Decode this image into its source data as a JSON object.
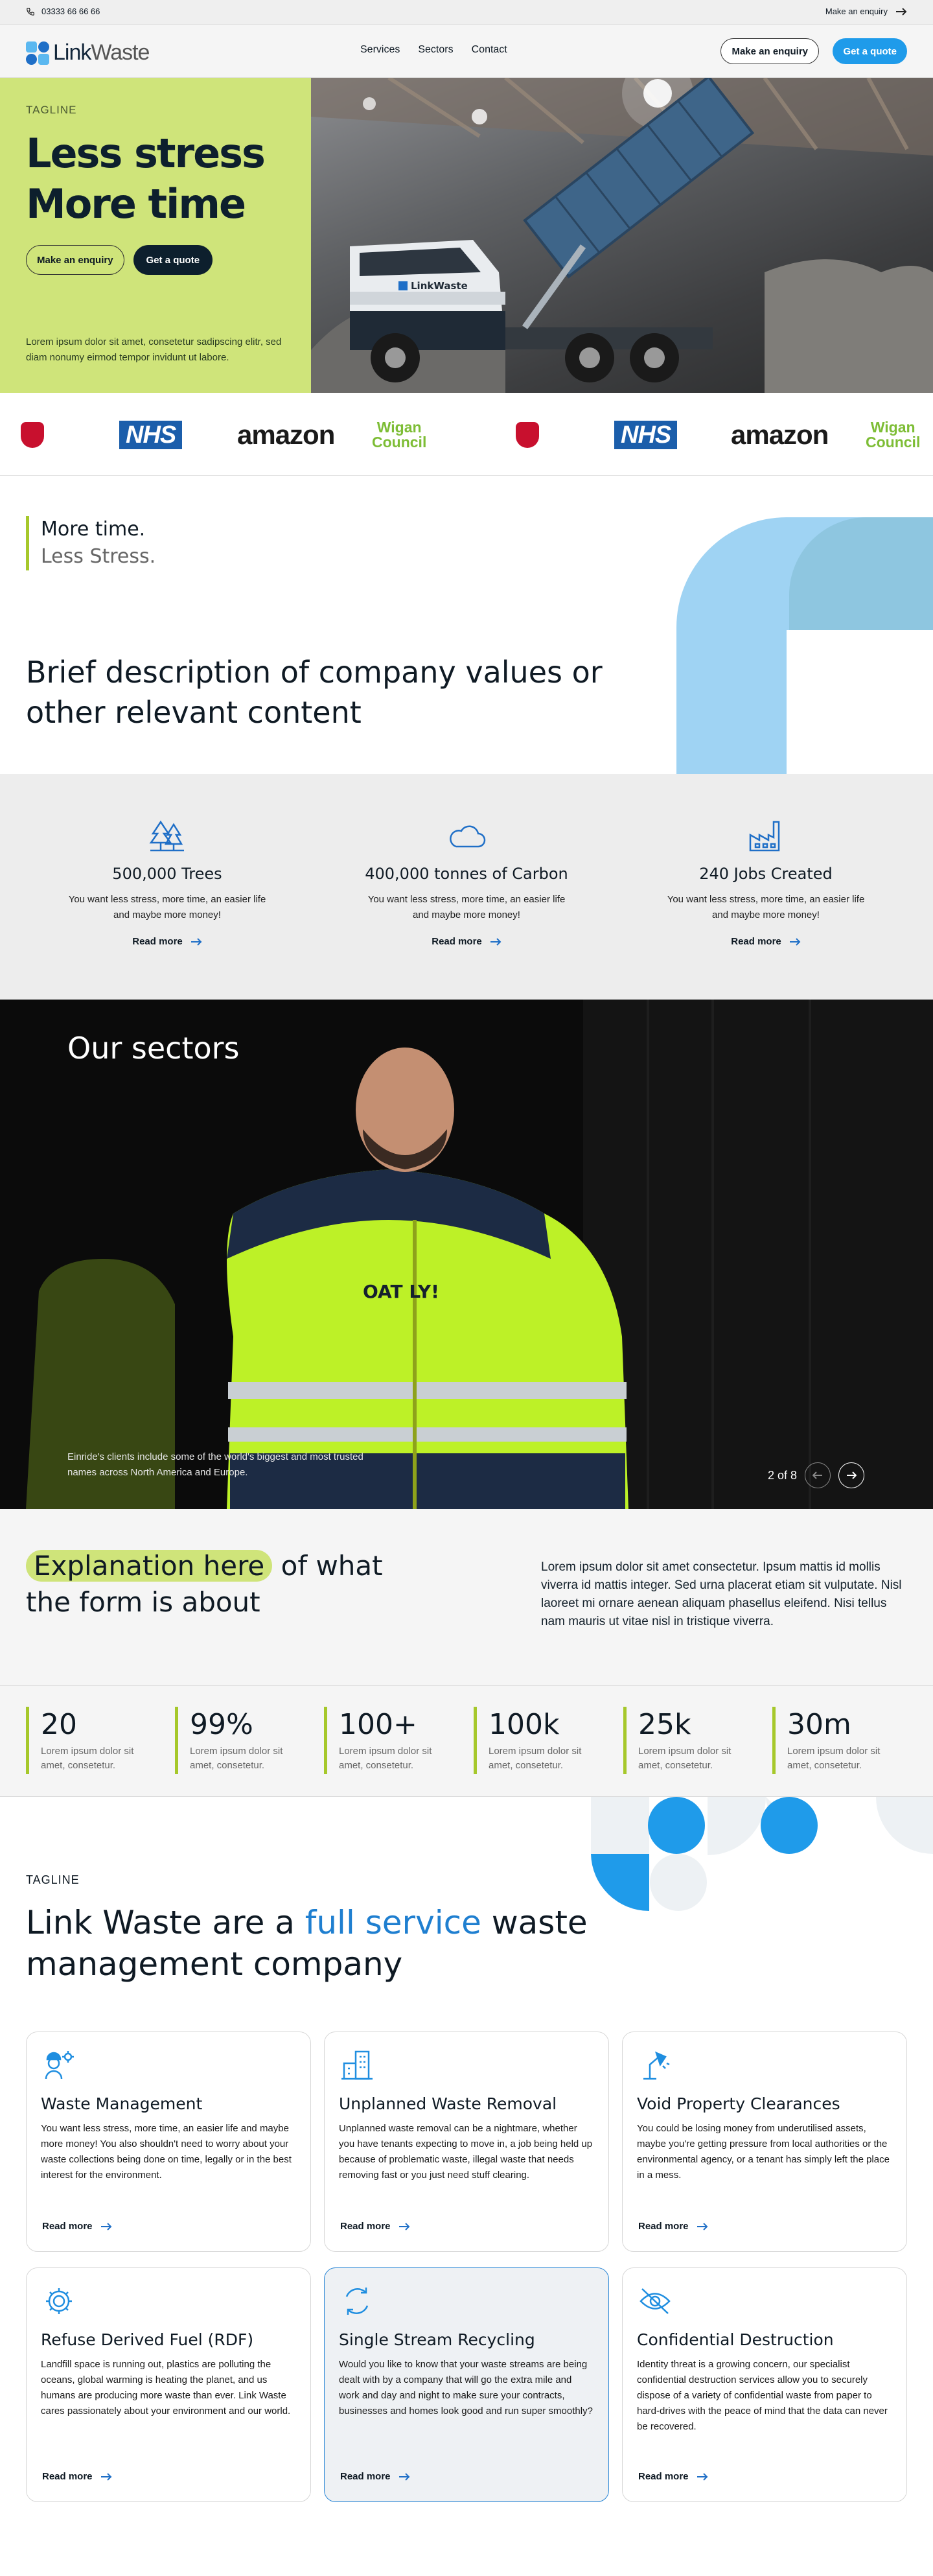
{
  "topbar": {
    "phone": "03333 66 66 66",
    "enquiry": "Make an enquiry"
  },
  "header": {
    "logo_link": "Link",
    "logo_waste": "Waste",
    "nav": [
      "Services",
      "Sectors",
      "Contact"
    ],
    "enquiry_button": "Make an enquiry",
    "quote_button": "Get a quote"
  },
  "hero": {
    "tagline": "TAGLINE",
    "title_line1": "Less stress",
    "title_line2": "More time",
    "enquiry_button": "Make an enquiry",
    "quote_button": "Get a quote",
    "description": "Lorem ipsum dolor sit amet, consetetur sadipscing elitr, sed diam nonumy eirmod tempor invidunt ut labore.",
    "truck_brand": "LinkWaste"
  },
  "clients": {
    "nhs": "NHS",
    "amazon": "amazon",
    "wigan_line1": "Wigan",
    "wigan_line2": "Council"
  },
  "values": {
    "quote_line1": "More time.",
    "quote_line2": "Less Stress.",
    "heading": "Brief description of company values or other relevant content"
  },
  "impact": [
    {
      "icon": "trees-icon",
      "title": "500,000 Trees",
      "text": "You want less stress, more time, an easier life and maybe more money!",
      "link": "Read more"
    },
    {
      "icon": "cloud-icon",
      "title": "400,000 tonnes of Carbon",
      "text": "You want less stress, more time, an easier life and maybe more money!",
      "link": "Read more"
    },
    {
      "icon": "factory-icon",
      "title": "240 Jobs Created",
      "text": "You want less stress, more time, an easier life and maybe more money!",
      "link": "Read more"
    }
  ],
  "sectors": {
    "title": "Our sectors",
    "caption": "Einride's clients include some of the world's biggest and most trusted names across North America and Europe.",
    "pager": "2 of 8",
    "jacket_print": "OAT LY!"
  },
  "explain": {
    "highlight": "Explanation here",
    "rest": " of what the form is about",
    "paragraph": "Lorem ipsum dolor sit amet consectetur. Ipsum mattis id mollis viverra id mattis integer. Sed urna placerat etiam sit vulputate. Nisl laoreet mi ornare aenean aliquam phasellus eleifend. Nisi tellus nam mauris ut vitae nisl in tristique viverra."
  },
  "stats": [
    {
      "value": "20",
      "label": "Lorem ipsum dolor sit amet, consetetur."
    },
    {
      "value": "99%",
      "label": "Lorem ipsum dolor sit amet, consetetur."
    },
    {
      "value": "100+",
      "label": "Lorem ipsum dolor sit amet, consetetur."
    },
    {
      "value": "100k",
      "label": "Lorem ipsum dolor sit amet, consetetur."
    },
    {
      "value": "25k",
      "label": "Lorem ipsum dolor sit amet, consetetur."
    },
    {
      "value": "30m",
      "label": "Lorem ipsum dolor sit amet, consetetur."
    }
  ],
  "services": {
    "tagline": "TAGLINE",
    "heading_pre": "Link Waste are a ",
    "heading_blue": "full service",
    "heading_post": " waste management company",
    "cards": [
      {
        "icon": "worker-gear-icon",
        "title": "Waste Management",
        "text": "You want less stress, more time, an easier life and maybe more money! You also shouldn't need to worry about your waste collections being done on time, legally or in the best interest for the environment.",
        "link": "Read more"
      },
      {
        "icon": "buildings-icon",
        "title": "Unplanned Waste Removal",
        "text": "Unplanned waste removal can be a nightmare, whether you have tenants expecting to move in, a job being held up because of problematic waste, illegal waste that needs removing fast or you just need stuff clearing.",
        "link": "Read more"
      },
      {
        "icon": "lamp-icon",
        "title": "Void Property Clearances",
        "text": "You could be losing money from underutilised assets, maybe you're getting pressure from local authorities or the environmental agency, or a tenant has simply left the place in a mess.",
        "link": "Read more"
      },
      {
        "icon": "gear-icon",
        "title": "Refuse Derived Fuel (RDF)",
        "text": "Landfill space is running out, plastics are polluting the oceans, global warming is heating the planet, and us humans are producing more waste than ever. Link Waste cares passionately about your environment and our world.",
        "link": "Read more"
      },
      {
        "icon": "recycle-icon",
        "title": "Single Stream Recycling",
        "text": "Would you like to know that your waste streams are being dealt with by a company that will go the extra mile and work and day and night to make sure your contracts, businesses and homes look good and run super smoothly?",
        "link": "Read more"
      },
      {
        "icon": "eye-slash-icon",
        "title": "Confidential Destruction",
        "text": "Identity threat is a growing concern, our specialist confidential destruction services allow you to securely dispose of a variety of confidential waste from paper to hard-drives with the peace of mind that the data can never be recovered.",
        "link": "Read more"
      }
    ]
  },
  "colors": {
    "lime": "#cfe47a",
    "accent_blue": "#1f9bea",
    "navy": "#0d1f2d",
    "light_blue": "#9fd3f3"
  }
}
